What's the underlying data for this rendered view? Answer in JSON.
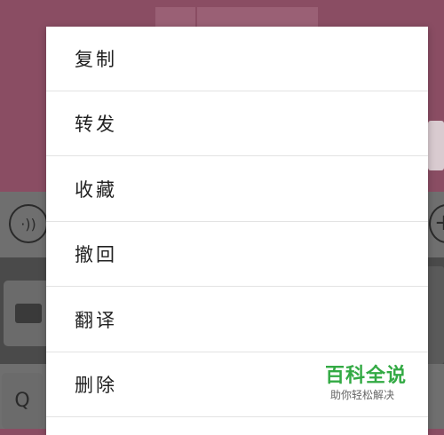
{
  "context_menu": {
    "items": [
      {
        "label": "复制"
      },
      {
        "label": "转发"
      },
      {
        "label": "收藏"
      },
      {
        "label": "撤回"
      },
      {
        "label": "翻译"
      },
      {
        "label": "删除"
      }
    ]
  },
  "watermark": {
    "title": "百科全说",
    "subtitle": "助你轻松解决"
  },
  "icons": {
    "voice": "voice-icon",
    "plus": "plus-icon",
    "keyboard": "keyboard-icon",
    "search": "search-icon"
  }
}
